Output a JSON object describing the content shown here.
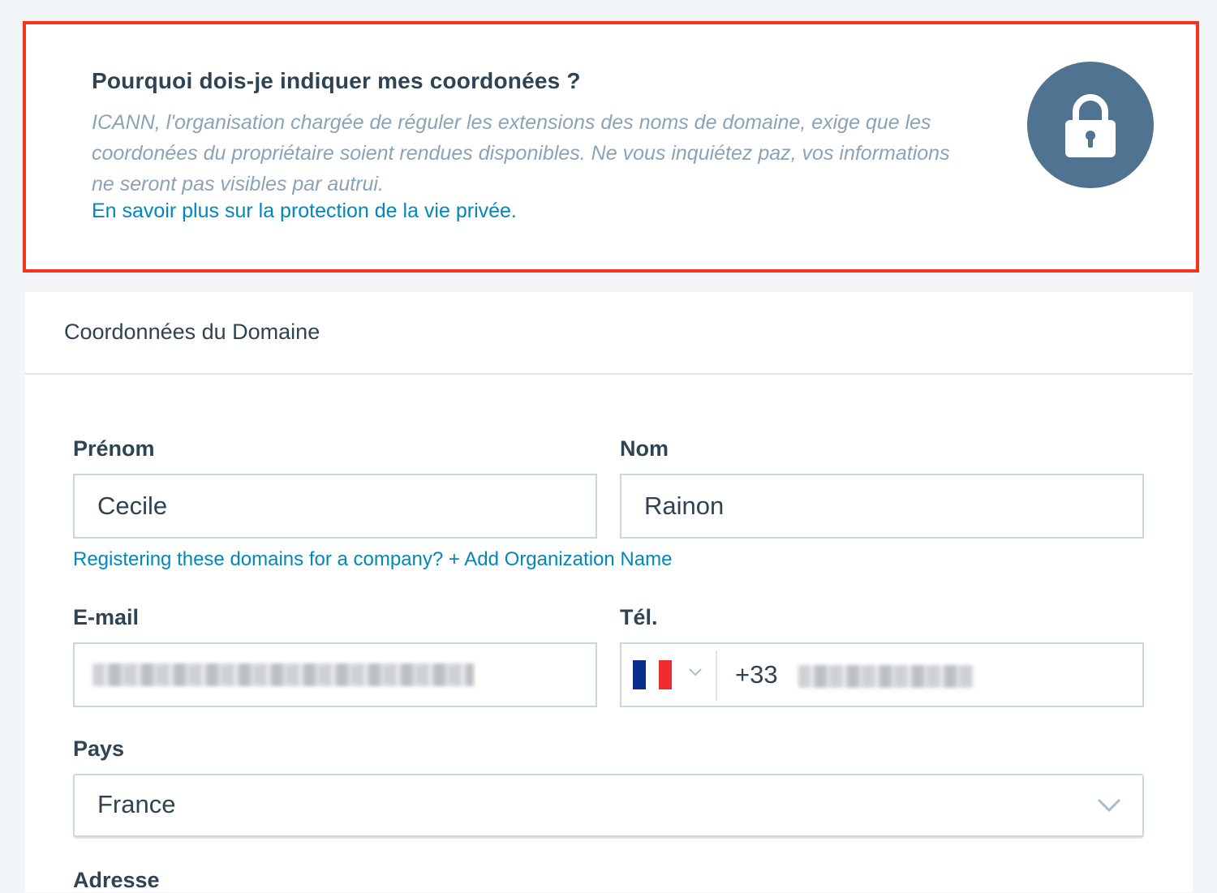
{
  "notice": {
    "title": "Pourquoi dois-je indiquer mes coordonées ?",
    "body": "ICANN, l'organisation chargée de réguler les extensions des noms de domaine, exige que les coordonées du propriétaire soient rendues disponibles. Ne vous inquiétez paz, vos informations ne seront pas visibles par autrui.",
    "link": "En savoir plus sur la protection de la vie privée.",
    "icon": "lock-icon",
    "highlight_color": "#f5341c",
    "icon_bg_color": "#4f7391"
  },
  "contact_card": {
    "title": "Coordonnées du Domaine",
    "first_name": {
      "label": "Prénom",
      "value": "Cecile"
    },
    "last_name": {
      "label": "Nom",
      "value": "Rainon"
    },
    "org_link": "Registering these domains for a company? + Add Organization Name",
    "email": {
      "label": "E-mail",
      "value": "[redacted]"
    },
    "phone": {
      "label": "Tél.",
      "country_flag": "france-flag-icon",
      "prefix": "+33",
      "value": "[redacted]"
    },
    "country": {
      "label": "Pays",
      "selected": "France"
    },
    "address_label": "Adresse"
  },
  "colors": {
    "link": "#0087be",
    "text": "#2e4453",
    "muted": "#8aa3b7",
    "border": "#c8d7e1"
  }
}
